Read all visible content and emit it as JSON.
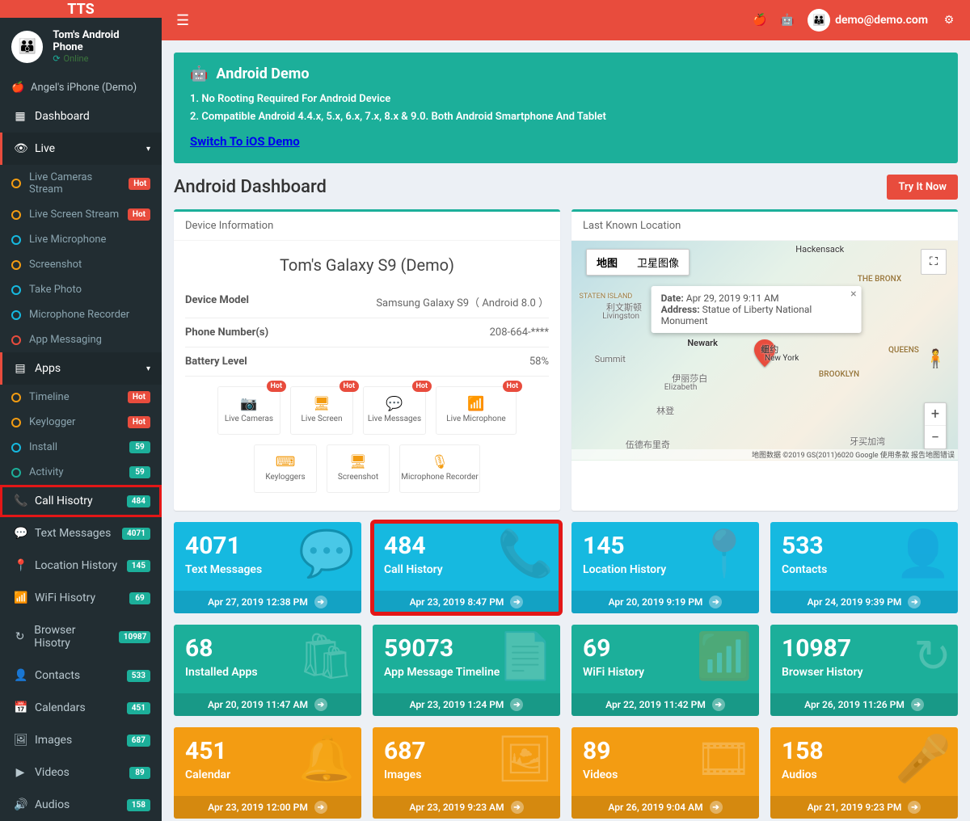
{
  "logo": "TTS",
  "user_email": "demo@demo.com",
  "device_panel": {
    "name": "Tom's Android Phone",
    "status": "Online"
  },
  "sidebar": {
    "iphone_demo": "Angel's iPhone (Demo)",
    "dashboard": "Dashboard",
    "live_header": "Live",
    "live_items": [
      {
        "label": "Live Cameras Stream",
        "color": "#f39c12",
        "badge": "Hot",
        "badge_class": "hot"
      },
      {
        "label": "Live Screen Stream",
        "color": "#f39c12",
        "badge": "Hot",
        "badge_class": "hot"
      },
      {
        "label": "Live Microphone",
        "color": "#16b9e0",
        "badge": "",
        "badge_class": ""
      },
      {
        "label": "Screenshot",
        "color": "#f39c12",
        "badge": "",
        "badge_class": ""
      },
      {
        "label": "Take Photo",
        "color": "#16b9e0",
        "badge": "",
        "badge_class": ""
      },
      {
        "label": "Microphone Recorder",
        "color": "#16b9e0",
        "badge": "",
        "badge_class": ""
      },
      {
        "label": "App Messaging",
        "color": "#e84c3d",
        "badge": "",
        "badge_class": ""
      }
    ],
    "apps_header": "Apps",
    "apps_items": [
      {
        "label": "Timeline",
        "color": "#f39c12",
        "badge": "Hot",
        "badge_class": "hot"
      },
      {
        "label": "Keylogger",
        "color": "#f39c12",
        "badge": "Hot",
        "badge_class": "hot"
      },
      {
        "label": "Install",
        "color": "#16b9e0",
        "badge": "59",
        "badge_class": "green"
      },
      {
        "label": "Activity",
        "color": "#1caf9a",
        "badge": "59",
        "badge_class": "green"
      }
    ],
    "call_history": {
      "label": "Call Hisotry",
      "badge": "484"
    },
    "rest": [
      {
        "icon": "💬",
        "label": "Text Messages",
        "badge": "4071"
      },
      {
        "icon": "📍",
        "label": "Location History",
        "badge": "145"
      },
      {
        "icon": "📶",
        "label": "WiFi Hisotry",
        "badge": "69"
      },
      {
        "icon": "↻",
        "label": "Browser Hisotry",
        "badge": "10987"
      },
      {
        "icon": "👤",
        "label": "Contacts",
        "badge": "533"
      },
      {
        "icon": "📅",
        "label": "Calendars",
        "badge": "451"
      },
      {
        "icon": "🖼",
        "label": "Images",
        "badge": "687"
      },
      {
        "icon": "▶",
        "label": "Videos",
        "badge": "89"
      },
      {
        "icon": "🔊",
        "label": "Audios",
        "badge": "158"
      }
    ]
  },
  "banner": {
    "title": "Android Demo",
    "line1": "1. No Rooting Required For Android Device",
    "line2": "2. Compatible Android 4.4.x, 5.x, 6.x, 7.x, 8.x & 9.0. Both Android Smartphone And Tablet",
    "switch": "Switch To iOS Demo"
  },
  "page_title": "Android Dashboard",
  "try_it": "Try It Now",
  "devinfo": {
    "head": "Device Information",
    "title": "Tom's Galaxy S9 (Demo)",
    "rows": [
      {
        "k": "Device Model",
        "v": "Samsung Galaxy S9（ Android 8.0 ）"
      },
      {
        "k": "Phone Number(s)",
        "v": "208-664-****"
      },
      {
        "k": "Battery Level",
        "v": "58%"
      }
    ],
    "quick": [
      {
        "label": "Live Cameras",
        "hot": true
      },
      {
        "label": "Live Screen",
        "hot": true
      },
      {
        "label": "Live Messages",
        "hot": true
      },
      {
        "label": "Live Microphone",
        "hot": true
      },
      {
        "label": "Keyloggers",
        "hot": false
      },
      {
        "label": "Screenshot",
        "hot": false
      },
      {
        "label": "Microphone Recorder",
        "hot": false
      }
    ]
  },
  "map": {
    "head": "Last Known Location",
    "type_map": "地图",
    "type_sat": "卫星图像",
    "date_label": "Date:",
    "date_value": "Apr 29, 2019 9:11 AM",
    "addr_label": "Address:",
    "addr_value": "Statue of Liberty National Monument",
    "attrib": "地图数据 ©2019 GS(2011)6020 Google  使用条款  报告地图错误",
    "labels": {
      "hackensack": "Hackensack",
      "livingston": "Livingston",
      "newark": "Newark",
      "summit": "Summit",
      "elizabeth": "Elizabeth",
      "ny_cn": "纽约",
      "ny_en": "New York",
      "bronx": "THE BRONX",
      "queens": "QUEENS",
      "brooklyn": "BROOKLYN",
      "staten": "STATEN ISLAND",
      "eliz_cn": "伊丽莎白",
      "linden": "林登",
      "woodbridge": "伍德布里奇",
      "jamaica": "牙买加湾",
      "lieston": "利文斯顿"
    }
  },
  "stats_rows": [
    [
      {
        "cls": "sky",
        "num": "4071",
        "lab": "Text Messages",
        "ts": "Apr 27, 2019 12:38 PM",
        "icon": "💬",
        "highlight": false
      },
      {
        "cls": "sky",
        "num": "484",
        "lab": "Call History",
        "ts": "Apr 23, 2019 8:47 PM",
        "icon": "📞",
        "highlight": true
      },
      {
        "cls": "sky",
        "num": "145",
        "lab": "Location History",
        "ts": "Apr 20, 2019 9:19 PM",
        "icon": "📍",
        "highlight": false
      },
      {
        "cls": "sky",
        "num": "533",
        "lab": "Contacts",
        "ts": "Apr 24, 2019 9:39 PM",
        "icon": "👤",
        "highlight": false
      }
    ],
    [
      {
        "cls": "grn",
        "num": "68",
        "lab": "Installed Apps",
        "ts": "Apr 20, 2019 11:47 AM",
        "icon": "🛍",
        "highlight": false
      },
      {
        "cls": "grn",
        "num": "59073",
        "lab": "App Message Timeline",
        "ts": "Apr 23, 2019 1:24 PM",
        "icon": "📄",
        "highlight": false
      },
      {
        "cls": "grn",
        "num": "69",
        "lab": "WiFi History",
        "ts": "Apr 22, 2019 11:42 PM",
        "icon": "📶",
        "highlight": false
      },
      {
        "cls": "grn",
        "num": "10987",
        "lab": "Browser History",
        "ts": "Apr 26, 2019 11:26 PM",
        "icon": "↻",
        "highlight": false
      }
    ],
    [
      {
        "cls": "org",
        "num": "451",
        "lab": "Calendar",
        "ts": "Apr 23, 2019 12:00 PM",
        "icon": "🔔",
        "highlight": false
      },
      {
        "cls": "org",
        "num": "687",
        "lab": "Images",
        "ts": "Apr 23, 2019 9:23 AM",
        "icon": "🖼",
        "highlight": false
      },
      {
        "cls": "org",
        "num": "89",
        "lab": "Videos",
        "ts": "Apr 26, 2019 9:04 AM",
        "icon": "🎞",
        "highlight": false
      },
      {
        "cls": "org",
        "num": "158",
        "lab": "Audios",
        "ts": "Apr 21, 2019 9:23 PM",
        "icon": "🎤",
        "highlight": false
      }
    ]
  ]
}
